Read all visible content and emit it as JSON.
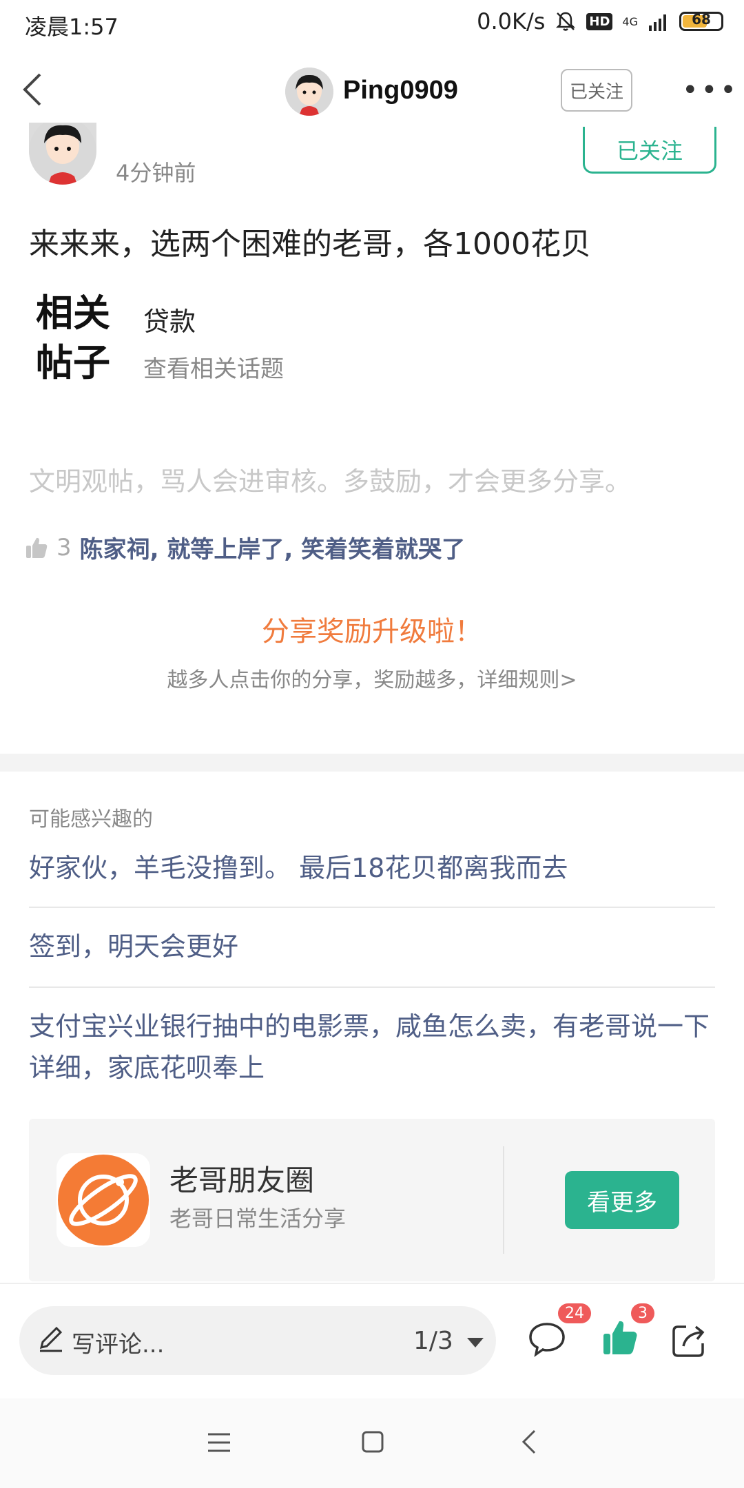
{
  "status": {
    "time": "凌晨1:57",
    "speed": "0.0K/s",
    "hd": "HD",
    "network": "4G",
    "battery": "68",
    "battery_level": 0.68
  },
  "header": {
    "username": "Ping0909",
    "follow_label": "已关注"
  },
  "post": {
    "author_partial": "Ping0909",
    "follow_label": "已关注",
    "time_ago": "4分钟前",
    "text": "来来来，选两个困难的老哥，各1000花贝",
    "related_logo_line1": "相关",
    "related_logo_line2": "帖子",
    "related_topic": "贷款",
    "related_sub": "查看相关话题",
    "civility_note": "文明观帖，骂人会进审核。多鼓励，才会更多分享。",
    "like_count": "3",
    "likers": "陈家祠, 就等上岸了, 笑着笑着就哭了",
    "share_title": "分享奖励升级啦！",
    "share_sub": "越多人点击你的分享，奖励越多，详细规则>"
  },
  "recommend": {
    "heading": "可能感兴趣的",
    "items": [
      "好家伙，羊毛没撸到。 最后18花贝都离我而去",
      "签到，明天会更好",
      "支付宝兴业银行抽中的电影票，咸鱼怎么卖，有老哥说一下详细，家底花呗奉上"
    ]
  },
  "card": {
    "name": "老哥朋友圈",
    "desc": "老哥日常生活分享",
    "button": "看更多"
  },
  "bottom": {
    "comment_placeholder": "写评论...",
    "page": "1/3",
    "comment_count": "24",
    "like_count": "3"
  },
  "colors": {
    "accent": "#2bb38f",
    "link": "#4f5e86",
    "orange": "#f07b3d",
    "badge": "#ef5a5a"
  }
}
